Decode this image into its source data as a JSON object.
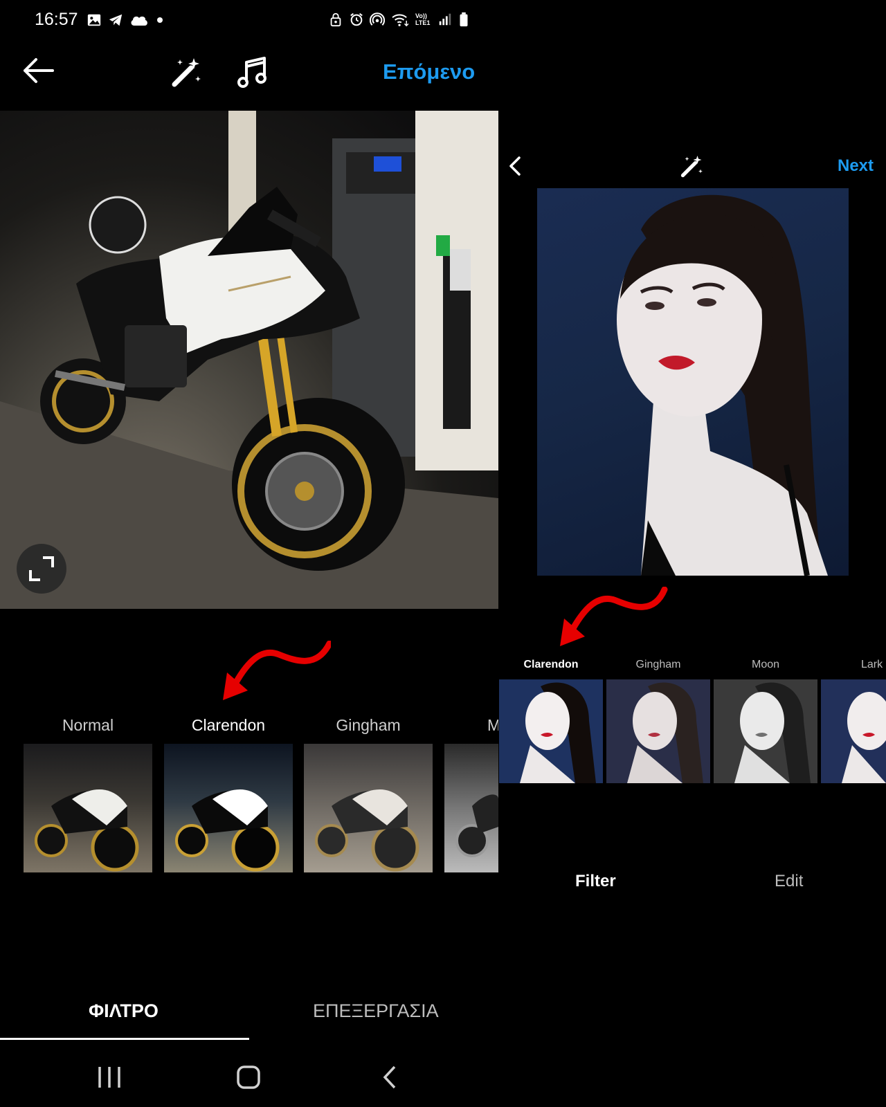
{
  "status_bar": {
    "time": "16:57",
    "left_icons": [
      "gallery-icon",
      "telegram-icon",
      "cloud-icon",
      "dot-icon"
    ],
    "right_icons": [
      "lock-icon",
      "alarm-icon",
      "hotspot-icon",
      "wifi-icon",
      "volte-icon",
      "signal-icon",
      "battery-icon"
    ],
    "volte_label": "Vo)) LTE1"
  },
  "left_screen": {
    "toolbar": {
      "back_icon": "arrow-left-icon",
      "magic_icon": "magic-wand-icon",
      "music_icon": "music-note-icon",
      "next_label": "Επόμενο"
    },
    "photo": {
      "subject": "motorcycle"
    },
    "filters": [
      {
        "label": "Normal",
        "active": false
      },
      {
        "label": "Clarendon",
        "active": true
      },
      {
        "label": "Gingham",
        "active": false
      },
      {
        "label": "M",
        "active": false
      }
    ],
    "tabs": {
      "filter_label": "ΦΙΛΤΡΟ",
      "edit_label": "ΕΠΕΞΕΡΓΑΣΙΑ",
      "selected": "filter"
    }
  },
  "right_screen": {
    "toolbar": {
      "back_icon": "chevron-left-icon",
      "magic_icon": "magic-wand-icon",
      "next_label": "Next"
    },
    "filters": [
      {
        "label": "Clarendon",
        "active": true
      },
      {
        "label": "Gingham",
        "active": false
      },
      {
        "label": "Moon",
        "active": false
      },
      {
        "label": "Lark",
        "active": false
      }
    ],
    "tabs": {
      "filter_label": "Filter",
      "edit_label": "Edit",
      "selected": "filter"
    }
  },
  "annotation_color": "#e60000",
  "accent_color": "#1d9bf0",
  "nav_bar": {
    "icons": [
      "recent-apps-icon",
      "home-icon",
      "back-icon"
    ]
  }
}
